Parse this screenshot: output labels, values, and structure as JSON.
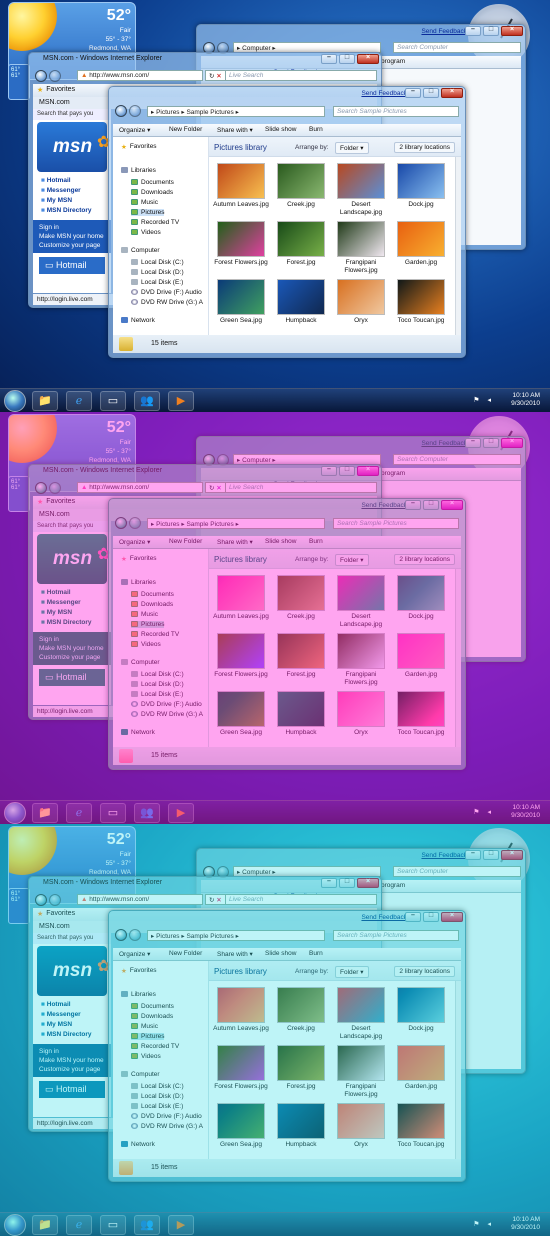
{
  "weather": {
    "temp": "52°",
    "cond": "Fair",
    "range": "55° - 37°",
    "city": "Redmond, WA",
    "side_temps": [
      "61°",
      "61°"
    ]
  },
  "computer_window": {
    "feedback": "Send Feedback",
    "address": "Computer",
    "search_placeholder": "Search Computer",
    "toolbar_text": "program",
    "snippet": "moving them"
  },
  "ie_window": {
    "title": "MSN.com - Windows Internet Explorer",
    "feedback": "Send Feedback",
    "url": "http://www.msn.com/",
    "search_placeholder": "Live Search",
    "favorites_label": "Favorites",
    "tab_label": "MSN.com",
    "msn_search": "Search that pays you",
    "msn_logo": "msn",
    "links": [
      "Hotmail",
      "Messenger",
      "My MSN",
      "MSN Directory"
    ],
    "sign_in": "Sign in",
    "make_home": "Make MSN your home",
    "customize": "Customize your page",
    "hotmail_btn": "Hotmail",
    "status": "http://login.live.com"
  },
  "explorer_window": {
    "feedback": "Send Feedback",
    "breadcrumb": [
      "Pictures",
      "Sample Pictures"
    ],
    "search_placeholder": "Search Sample Pictures",
    "toolbar": [
      "Organize",
      "New Folder",
      "Share with",
      "Slide show",
      "Burn"
    ],
    "nav": {
      "favorites": "Favorites",
      "libraries": "Libraries",
      "library_items": [
        "Documents",
        "Downloads",
        "Music",
        "Pictures",
        "Recorded TV",
        "Videos"
      ],
      "computer": "Computer",
      "drives": [
        "Local Disk (C:)",
        "Local Disk (D:)",
        "Local Disk (E:)",
        "DVD Drive (F:) Audio",
        "DVD RW Drive (G:) A"
      ],
      "network": "Network"
    },
    "library_title": "Pictures library",
    "arrange_label": "Arrange by:",
    "arrange_value": "Folder",
    "library_locations": "2 library locations",
    "thumbnails": [
      {
        "name": "Autumn Leaves.jpg",
        "c1": "#c04818",
        "c2": "#f8c050"
      },
      {
        "name": "Creek.jpg",
        "c1": "#2a5a1e",
        "c2": "#8ab870"
      },
      {
        "name": "Desert Landscape.jpg",
        "c1": "#b84820",
        "c2": "#5a90d8"
      },
      {
        "name": "Dock.jpg",
        "c1": "#1848a8",
        "c2": "#8ac0f0"
      },
      {
        "name": "Forest Flowers.jpg",
        "c1": "#206018",
        "c2": "#e040a0"
      },
      {
        "name": "Forest.jpg",
        "c1": "#184a18",
        "c2": "#78b048"
      },
      {
        "name": "Frangipani Flowers.jpg",
        "c1": "#203a18",
        "c2": "#f0e8f0"
      },
      {
        "name": "Garden.jpg",
        "c1": "#e86010",
        "c2": "#f8b030"
      },
      {
        "name": "Green Sea.jpg",
        "c1": "#0a3a78",
        "c2": "#40a060"
      },
      {
        "name": "Humpback",
        "c1": "#1a58b8",
        "c2": "#102850"
      },
      {
        "name": "Oryx",
        "c1": "#d87020",
        "c2": "#f0c8a0"
      },
      {
        "name": "Toco Toucan.jpg",
        "c1": "#101818",
        "c2": "#e88020"
      }
    ],
    "item_count": "15 items"
  },
  "taskbar": {
    "time": "10:10 AM",
    "date": "9/30/2010",
    "buttons": [
      "explorer",
      "ie",
      "media-center",
      "messenger",
      "media-player"
    ]
  }
}
